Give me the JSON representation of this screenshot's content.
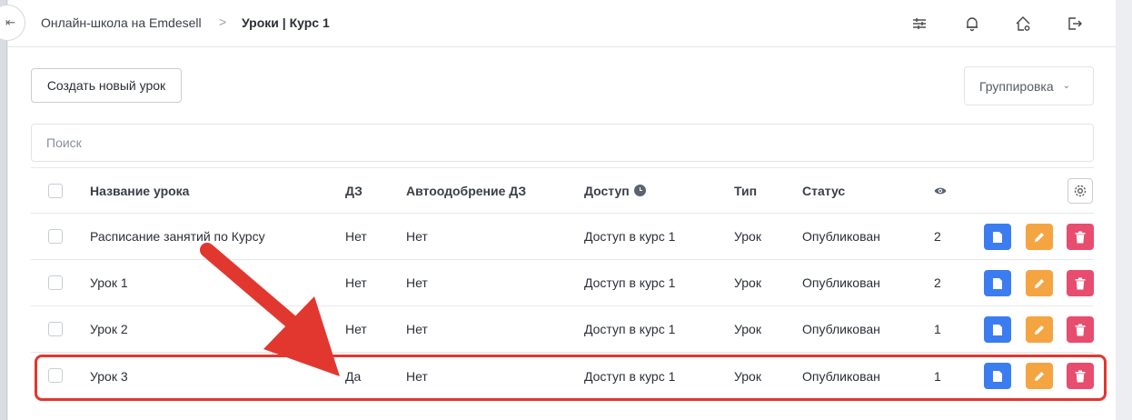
{
  "header": {
    "breadcrumb_school": "Онлайн-школа на Emdesell",
    "breadcrumb_separator": ">",
    "breadcrumb_current": "Уроки | Курс 1",
    "icons": [
      "sliders-icon",
      "bell-icon",
      "home-settings-icon",
      "logout-icon"
    ]
  },
  "toolbar": {
    "create_label": "Создать новый урок",
    "group_label": "Группировка"
  },
  "search": {
    "placeholder": "Поиск"
  },
  "table": {
    "columns": {
      "name": "Название урока",
      "dz": "ДЗ",
      "auto": "Автоодобрение ДЗ",
      "access": "Доступ",
      "type": "Тип",
      "status": "Статус"
    },
    "rows": [
      {
        "name": "Расписание занятий по Курсу",
        "dz": "Нет",
        "auto": "Нет",
        "access": "Доступ в курс 1",
        "type": "Урок",
        "status": "Опубликован",
        "views": "2"
      },
      {
        "name": "Урок 1",
        "dz": "Нет",
        "auto": "Нет",
        "access": "Доступ в курс 1",
        "type": "Урок",
        "status": "Опубликован",
        "views": "2"
      },
      {
        "name": "Урок 2",
        "dz": "Нет",
        "auto": "Нет",
        "access": "Доступ в курс 1",
        "type": "Урок",
        "status": "Опубликован",
        "views": "1"
      },
      {
        "name": "Урок 3",
        "dz": "Да",
        "auto": "Нет",
        "access": "Доступ в курс 1",
        "type": "Урок",
        "status": "Опубликован",
        "views": "1"
      }
    ]
  },
  "colors": {
    "view_button": "#3b7df0",
    "edit_button": "#f5a442",
    "delete_button": "#e84c6e",
    "annotation": "#e2372f"
  }
}
